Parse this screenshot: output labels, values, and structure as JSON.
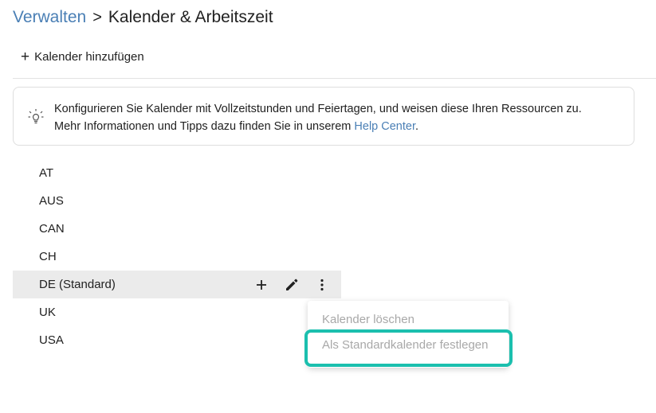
{
  "breadcrumb": {
    "parent": "Verwalten",
    "separator": ">",
    "current": "Kalender & Arbeitszeit"
  },
  "toolbar": {
    "add_calendar_label": "Kalender hinzufügen"
  },
  "info": {
    "line1": "Konfigurieren Sie Kalender mit Vollzeitstunden und Feiertagen, und weisen diese Ihren Ressourcen zu.",
    "line2_prefix": "Mehr Informationen und Tipps dazu finden Sie in unserem ",
    "link": "Help Center",
    "line2_suffix": "."
  },
  "calendars": [
    "AT",
    "AUS",
    "CAN",
    "CH",
    "DE (Standard)",
    "UK",
    "USA"
  ],
  "selected_calendar_index": 4,
  "context_menu": {
    "items": [
      "Kalender löschen",
      "Als Standardkalender festlegen"
    ],
    "highlighted_index": 1
  },
  "colors": {
    "link": "#4a7fb5",
    "highlight": "#1bbfae",
    "row_selected": "#ebebeb",
    "menu_disabled_text": "#a8a8a8"
  },
  "icons": {
    "info": "lightbulb-icon",
    "row_add": "plus-icon",
    "row_edit": "pencil-icon",
    "row_more": "more-vertical-icon"
  }
}
